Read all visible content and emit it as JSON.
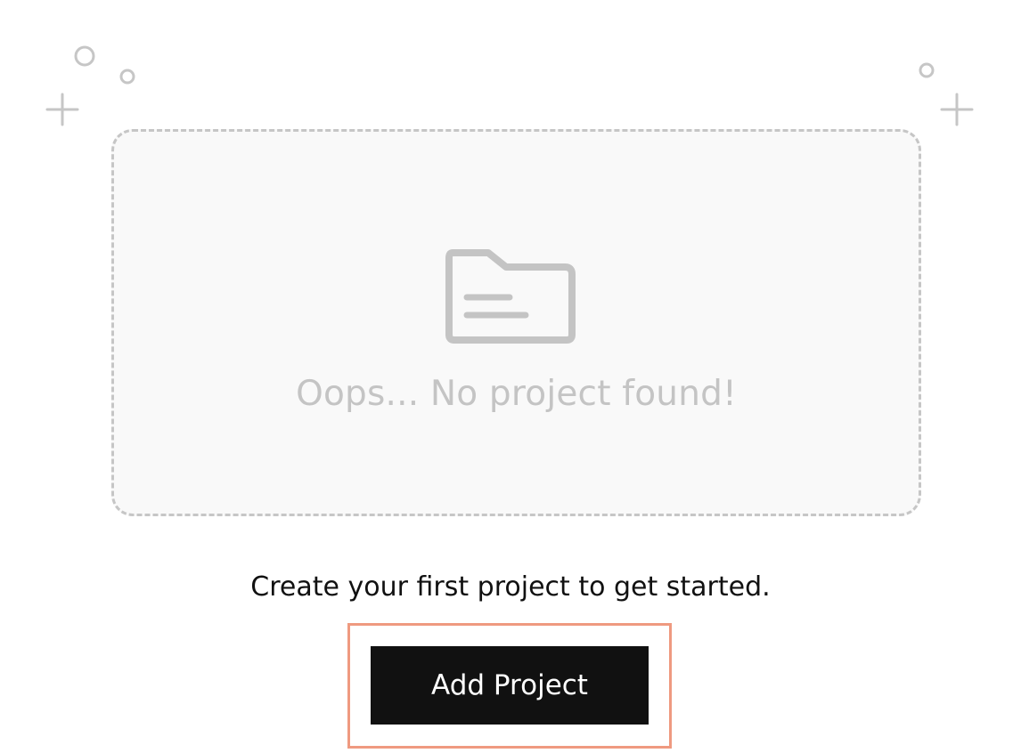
{
  "empty_state": {
    "message": "Oops... No project found!",
    "icon": "folder-icon"
  },
  "prompt": {
    "text": "Create your first project to get started."
  },
  "actions": {
    "add_project_label": "Add Project"
  },
  "colors": {
    "card_border": "#c6c6c6",
    "card_background": "#f9f9f9",
    "muted_text": "#c4c4c4",
    "button_background": "#111111",
    "button_text": "#ffffff",
    "focus_ring": "#ef9a80"
  },
  "decorations": [
    "circle-icon",
    "circle-icon",
    "plus-icon",
    "circle-icon",
    "plus-icon"
  ]
}
